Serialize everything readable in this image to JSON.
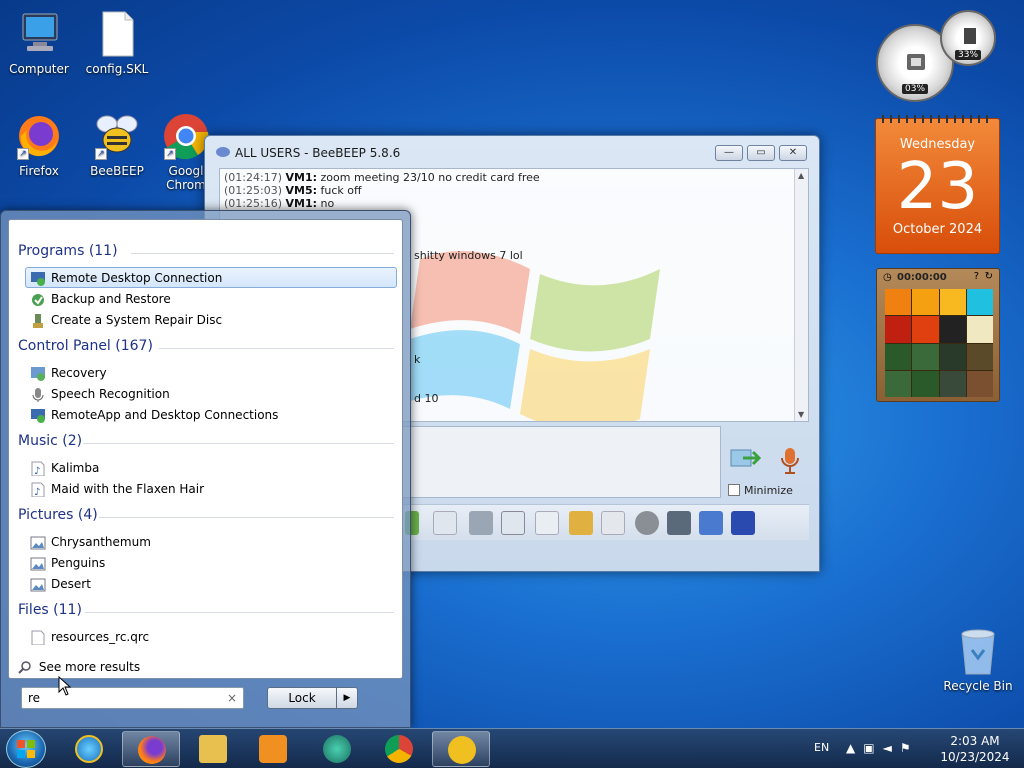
{
  "desktop": {
    "icons": [
      {
        "label": "Computer"
      },
      {
        "label": "config.SKL"
      },
      {
        "label": "Firefox"
      },
      {
        "label": "BeeBEEP"
      },
      {
        "label": "Googl Chrom"
      }
    ],
    "recycle_bin": "Recycle Bin"
  },
  "beebeep": {
    "title": "ALL USERS - BeeBEEP 5.8.6",
    "messages": [
      {
        "time": "(01:24:17)",
        "user": "VM1:",
        "text": " zoom meeting 23/10 no credit card free"
      },
      {
        "time": "(01:25:03)",
        "user": "VM5:",
        "text": " fuck off"
      },
      {
        "time": "(01:25:16)",
        "user": "VM1:",
        "text": " no"
      }
    ],
    "partial_lines": [
      "shitty windows 7 lol",
      "k",
      "d 10"
    ],
    "minimize_label": "Minimize"
  },
  "gadgets": {
    "cpu_pct": "03%",
    "mem_pct": "33%",
    "calendar": {
      "weekday": "Wednesday",
      "day": "23",
      "month": "October 2024"
    },
    "puzzle_timer": "00:00:00"
  },
  "start_menu": {
    "groups": [
      {
        "title": "Programs (11)",
        "items": [
          "Remote Desktop Connection",
          "Backup and Restore",
          "Create a System Repair Disc"
        ]
      },
      {
        "title": "Control Panel (167)",
        "items": [
          "Recovery",
          "Speech Recognition",
          "RemoteApp and Desktop Connections"
        ]
      },
      {
        "title": "Music (2)",
        "items": [
          "Kalimba",
          "Maid with the Flaxen Hair"
        ]
      },
      {
        "title": "Pictures (4)",
        "items": [
          "Chrysanthemum",
          "Penguins",
          "Desert"
        ]
      },
      {
        "title": "Files (11)",
        "items": [
          "resources_rc.qrc"
        ]
      }
    ],
    "see_more": "See more results",
    "search_value": "re",
    "lock_label": "Lock",
    "clear_glyph": "×",
    "arrow_glyph": "▶"
  },
  "taskbar": {
    "lang": "EN",
    "time": "2:03 AM",
    "date": "10/23/2024"
  },
  "colors": {
    "group_heading": "#1e3287",
    "calendar_orange": "#e8661c",
    "selection_border": "#84acdd"
  }
}
